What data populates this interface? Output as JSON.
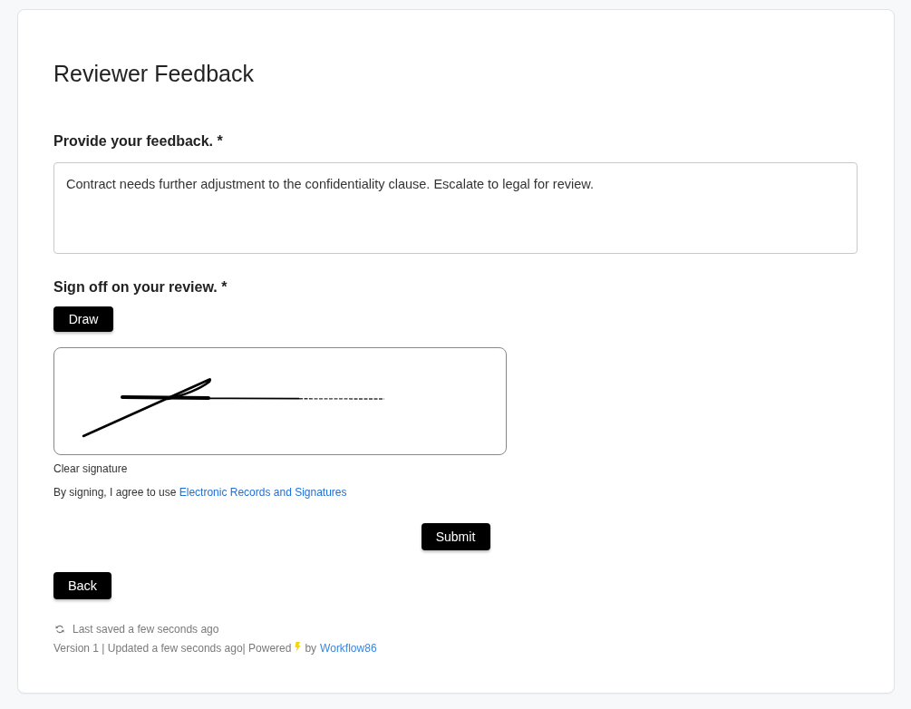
{
  "page": {
    "title": "Reviewer Feedback"
  },
  "feedback": {
    "label": "Provide your feedback. *",
    "value": "Contract needs further adjustment to the confidentiality clause. Escalate to legal for review."
  },
  "signature": {
    "label": "Sign off on your review. *",
    "draw_button": "Draw",
    "clear_link": "Clear signature",
    "consent_text": "By signing, I agree to use ",
    "consent_link": "Electronic Records and Signatures"
  },
  "actions": {
    "submit_button": "Submit",
    "back_button": "Back"
  },
  "footer": {
    "saved_text": "Last saved a few seconds ago",
    "version_text": "Version 1 | Updated a few seconds ago| Powered",
    "by_text": "by",
    "brand_link": "Workflow86"
  }
}
